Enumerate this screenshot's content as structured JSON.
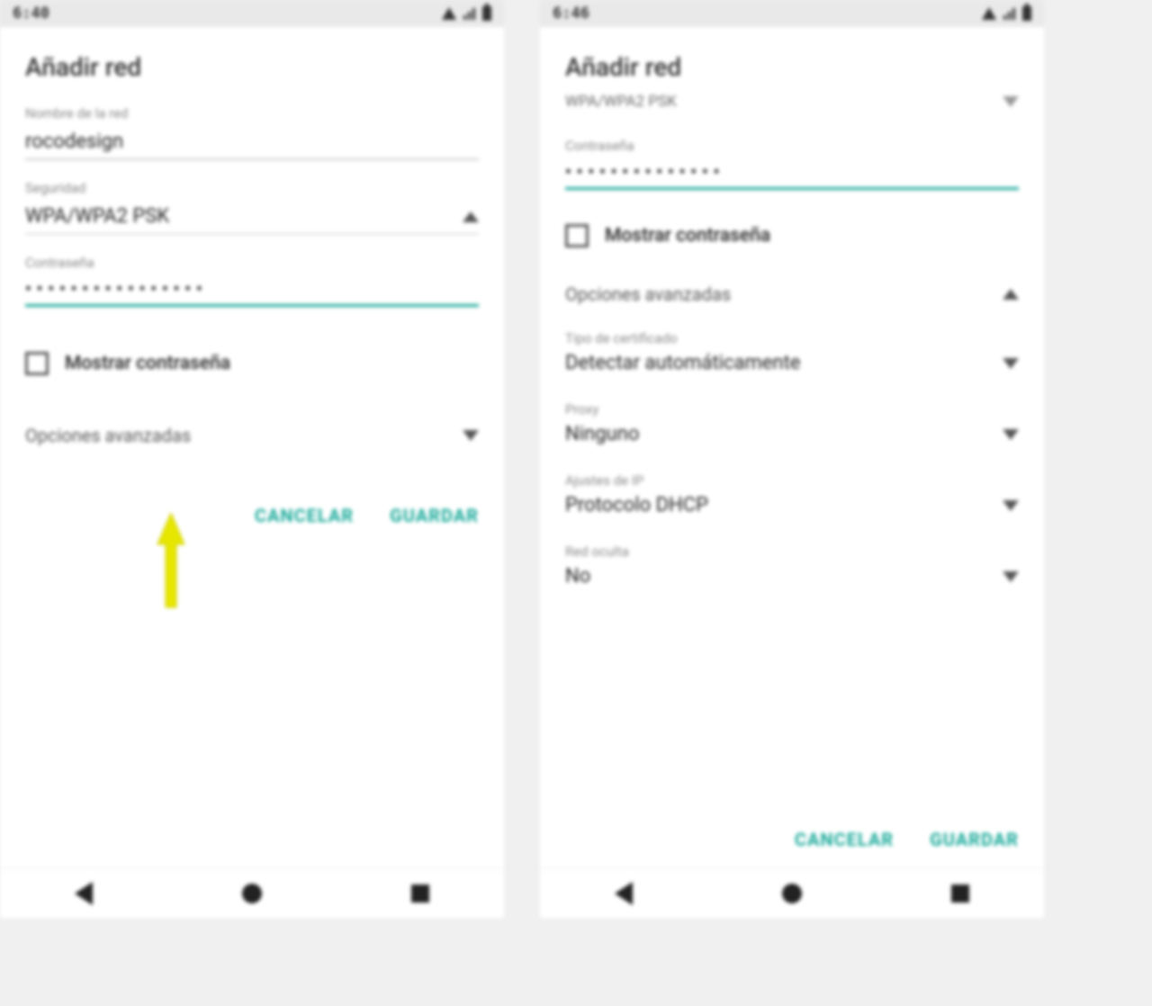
{
  "status": {
    "time_left": "6:40",
    "time_right": "6:46"
  },
  "left": {
    "title": "Añadir red",
    "ssid_label": "Nombre de la red",
    "ssid_value": "rocodesign",
    "security_label": "Seguridad",
    "security_value": "WPA/WPA2 PSK",
    "password_label": "Contraseña",
    "password_mask": "••••••••••••••••",
    "show_pw_label": "Mostrar contraseña",
    "advanced_label": "Opciones avanzadas",
    "btn_cancel": "CANCELAR",
    "btn_save": "GUARDAR"
  },
  "right": {
    "title": "Añadir red",
    "subtitle": "WPA/WPA2 PSK",
    "password_label": "Contraseña",
    "password_mask": "••••••••••••••",
    "show_pw_label": "Mostrar contraseña",
    "advanced_label": "Opciones avanzadas",
    "cert_label": "Tipo de certificado",
    "cert_value": "Detectar automáticamente",
    "proxy_label": "Proxy",
    "proxy_value": "Ninguno",
    "ip_label": "Ajustes de IP",
    "ip_value": "Protocolo DHCP",
    "hidden_label": "Red oculta",
    "hidden_value": "No",
    "btn_cancel": "CANCELAR",
    "btn_save": "GUARDAR"
  }
}
